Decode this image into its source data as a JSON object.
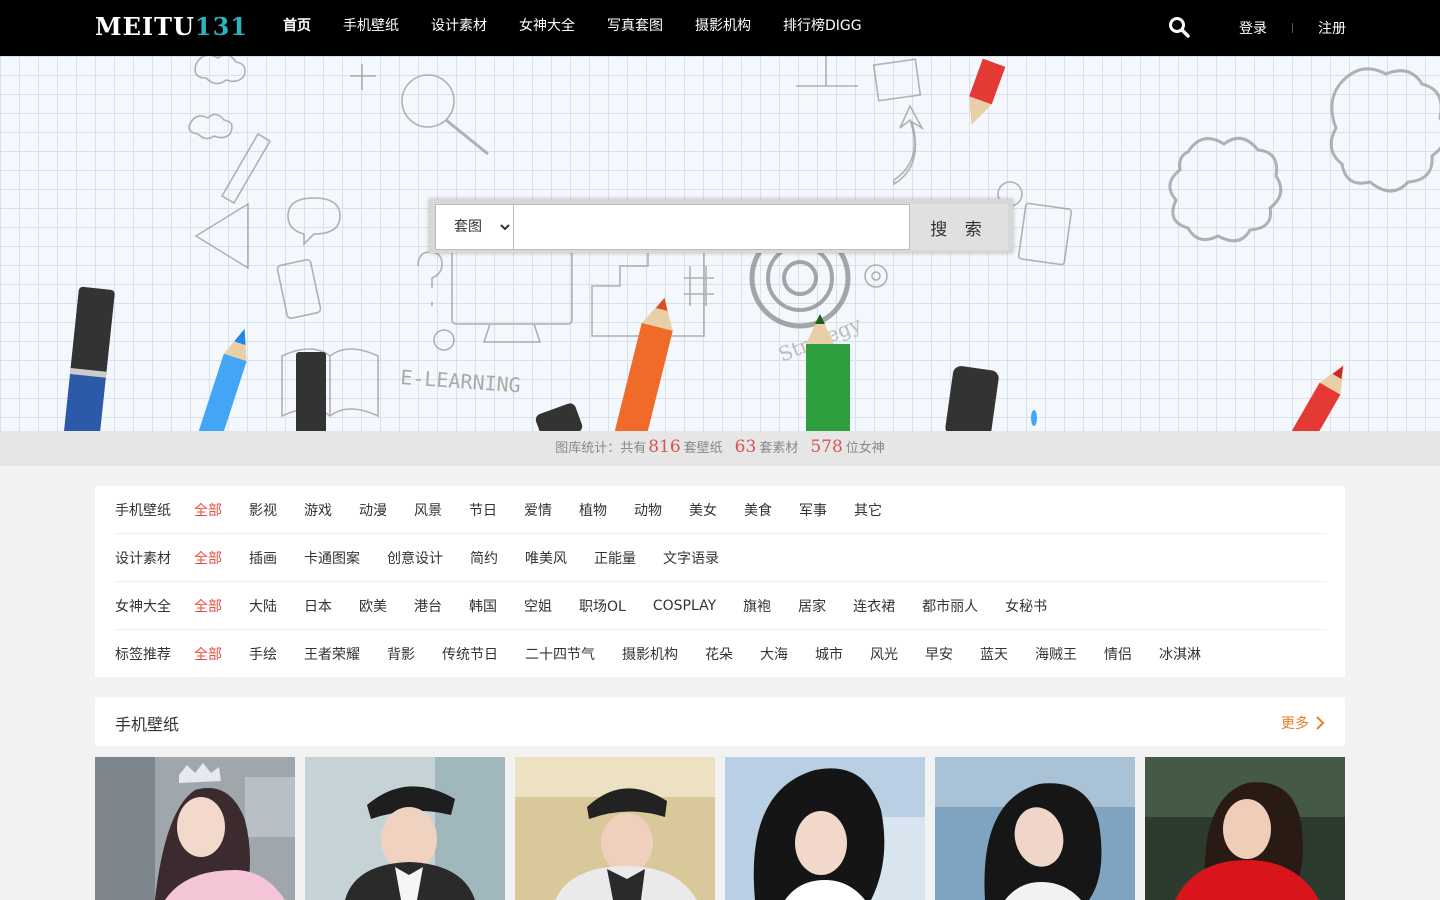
{
  "nav": {
    "logo_main": "MEITU",
    "logo_num": "131",
    "items": [
      {
        "label": "首页",
        "active": true
      },
      {
        "label": "手机壁纸"
      },
      {
        "label": "设计素材"
      },
      {
        "label": "女神大全"
      },
      {
        "label": "写真套图"
      },
      {
        "label": "摄影机构"
      },
      {
        "label": "排行榜DIGG"
      }
    ],
    "login": "登录",
    "register": "注册"
  },
  "banner": {
    "decor_text": "E-LEARNING",
    "decor_text2": "Strategy",
    "search": {
      "select_value": "套图",
      "placeholder": "",
      "button": "搜 索"
    }
  },
  "stats": {
    "prefix": "图库统计：共有",
    "wallpaper_count": "816",
    "wallpaper_unit": "套壁纸",
    "material_count": "63",
    "material_unit": "套素材",
    "goddess_count": "578",
    "goddess_unit": "位女神"
  },
  "categories": [
    {
      "label": "手机壁纸",
      "items": [
        "全部",
        "影视",
        "游戏",
        "动漫",
        "风景",
        "节日",
        "爱情",
        "植物",
        "动物",
        "美女",
        "美食",
        "军事",
        "其它"
      ]
    },
    {
      "label": "设计素材",
      "items": [
        "全部",
        "插画",
        "卡通图案",
        "创意设计",
        "简约",
        "唯美风",
        "正能量",
        "文字语录"
      ]
    },
    {
      "label": "女神大全",
      "items": [
        "全部",
        "大陆",
        "日本",
        "欧美",
        "港台",
        "韩国",
        "空姐",
        "职场OL",
        "COSPLAY",
        "旗袍",
        "居家",
        "连衣裙",
        "都市丽人",
        "女秘书"
      ]
    },
    {
      "label": "标签推荐",
      "items": [
        "全部",
        "手绘",
        "王者荣耀",
        "背影",
        "传统节日",
        "二十四节气",
        "摄影机构",
        "花朵",
        "大海",
        "城市",
        "风光",
        "早安",
        "蓝天",
        "海贼王",
        "情侣",
        "冰淇淋"
      ]
    }
  ],
  "section": {
    "title": "手机壁纸",
    "more": "更多"
  },
  "colors": {
    "accent_red": "#e74c3c",
    "more_orange": "#e67e22",
    "topbar": "#000000"
  }
}
